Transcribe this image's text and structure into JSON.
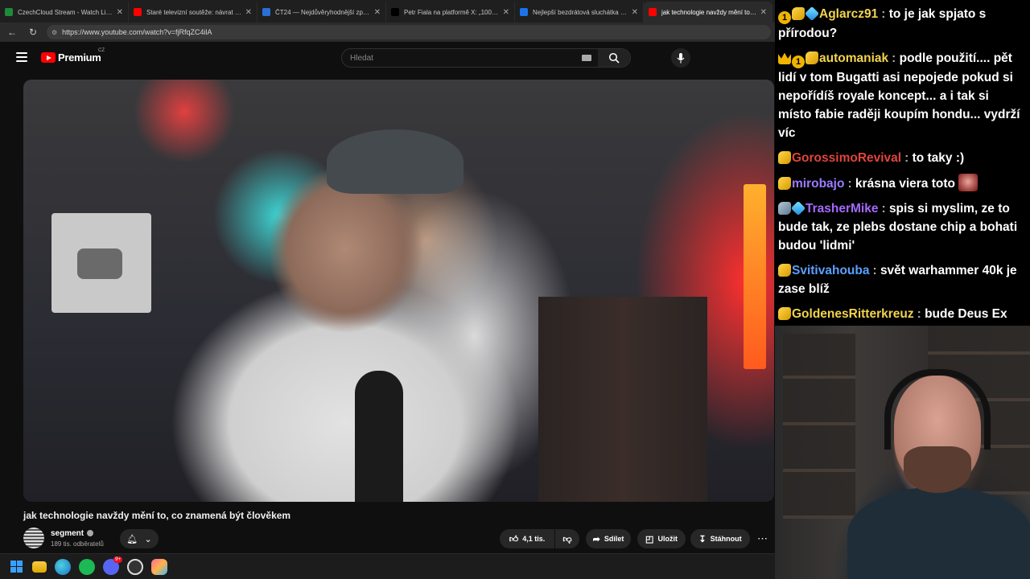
{
  "browser": {
    "tabs": [
      {
        "title": "CzechCloud Stream - Watch Live o",
        "favicon_color": "#1e8a3a"
      },
      {
        "title": "Staré televizní soutěže: návrat do s",
        "favicon_color": "#ff0000"
      },
      {
        "title": "ČT24 — Nejdůvěryhodnější zpravo",
        "favicon_color": "#2a6fd6"
      },
      {
        "title": "Petr Fiala na platformě X: „100 dní",
        "favicon_color": "#000000"
      },
      {
        "title": "Nejlepší bezdrátová sluchátka 202",
        "favicon_color": "#1a73e8"
      },
      {
        "title": "jak technologie navždy mění to, co",
        "favicon_color": "#ff0000",
        "active": true
      }
    ],
    "url": "https://www.youtube.com/watch?v=fjRfqZC4ilA"
  },
  "youtube": {
    "logo_text": "Premium",
    "country": "CZ",
    "search_placeholder": "Hledat",
    "video_title": "jak technologie navždy mění to, co znamená být člověkem",
    "channel_name": "segment",
    "subscribers": "189 tis. odběratelů",
    "likes": "4,1 tis.",
    "share_label": "Sdílet",
    "save_label": "Uložit",
    "download_label": "Stáhnout"
  },
  "chat": {
    "messages": [
      {
        "badges": [
          "one",
          "hand",
          "cube"
        ],
        "user": "Aglarcz91",
        "color": "#f2d44d",
        "text": "to je jak spjato s přírodou?"
      },
      {
        "badges": [
          "crown",
          "one",
          "hand"
        ],
        "user": "automaniak",
        "color": "#f2d44d",
        "text": "podle použití.... pět lidí v tom Bugatti asi nepojede pokud si nepořídíš royale koncept... a i tak si místo fabie raději koupím hondu... vydrží víc"
      },
      {
        "badges": [
          "hand"
        ],
        "user": "GorossimoRevival",
        "color": "#e0453c",
        "text": "to taky :)"
      },
      {
        "badges": [
          "hand"
        ],
        "user": "mirobajo",
        "color": "#9b7bff",
        "text": "krásna viera toto",
        "emote": true
      },
      {
        "badges": [
          "arm",
          "cube"
        ],
        "user": "TrasherMike",
        "color": "#a569ff",
        "text": "spis si myslim, ze to bude tak, ze plebs dostane chip a bohati budou 'lidmi'"
      },
      {
        "badges": [
          "hand"
        ],
        "user": "Svitivahouba",
        "color": "#5aa0ff",
        "text": "svět warhammer 40k je zase blíž"
      },
      {
        "badges": [
          "hand"
        ],
        "user": "GoldenesRitterkreuz",
        "color": "#f2d44d",
        "text": "bude Deus Ex"
      }
    ]
  },
  "taskbar": {
    "discord_badge": "9+"
  }
}
